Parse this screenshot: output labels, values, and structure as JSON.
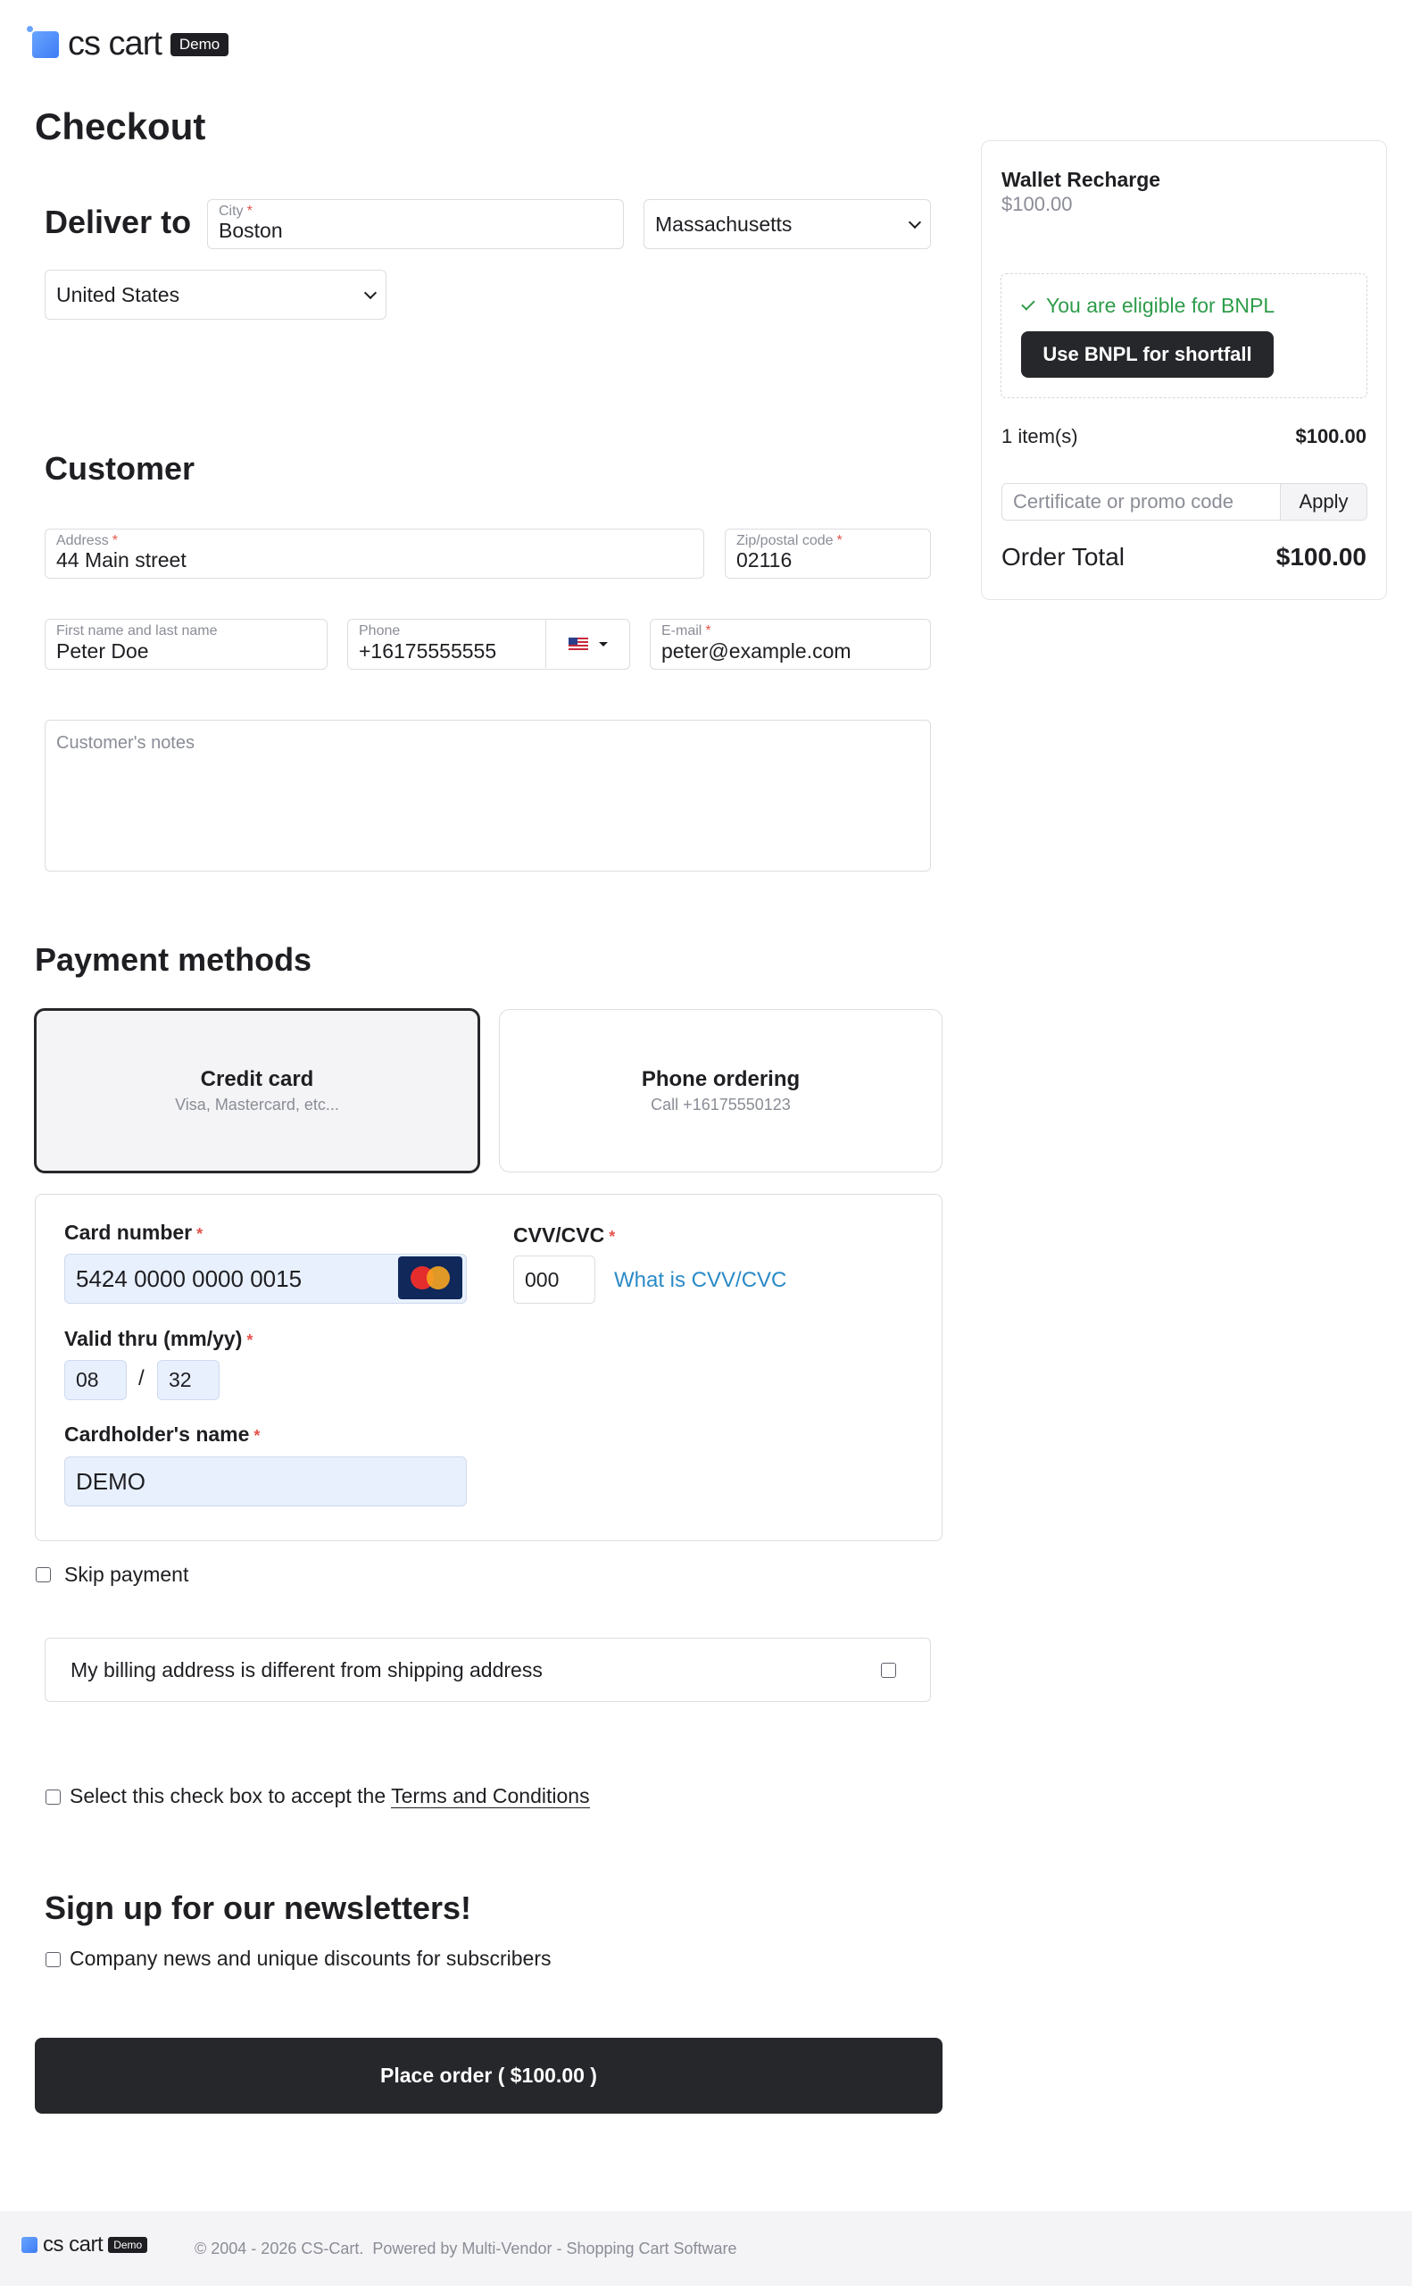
{
  "header": {
    "logo_text": "cs cart",
    "badge": "Demo"
  },
  "page_title": "Checkout",
  "deliver": {
    "title": "Deliver to",
    "city_label": "City",
    "city_value": "Boston",
    "state_value": "Massachusetts",
    "country_value": "United States"
  },
  "customer": {
    "title": "Customer",
    "address_label": "Address",
    "address_value": "44 Main street",
    "zip_label": "Zip/postal code",
    "zip_value": "02116",
    "name_label": "First name and last name",
    "name_value": "Peter Doe",
    "phone_label": "Phone",
    "phone_value": "+16175555555",
    "email_label": "E-mail",
    "email_value": "peter@example.com",
    "notes_placeholder": "Customer's notes"
  },
  "payment": {
    "title": "Payment methods",
    "methods": [
      {
        "title": "Credit card",
        "subtitle": "Visa, Mastercard, etc..."
      },
      {
        "title": "Phone ordering",
        "subtitle": "Call +16175550123"
      }
    ],
    "card_number_label": "Card number",
    "card_number_value": "5424 0000 0000 0015",
    "card_brand": "MasterCard",
    "cvv_label": "CVV/CVC",
    "cvv_value": "000",
    "cvv_link": "What is CVV/CVC",
    "valid_thru_label": "Valid thru (mm/yy)",
    "month_value": "08",
    "slash": "/",
    "year_value": "32",
    "holder_label": "Cardholder's name",
    "holder_value": "DEMO",
    "skip_label": "Skip payment"
  },
  "billing_different_label": "My billing address is different from shipping address",
  "terms": {
    "prefix": "Select this check box to accept the",
    "link": "Terms and Conditions"
  },
  "newsletter": {
    "title": "Sign up for our newsletters!",
    "option": "Company news and unique discounts for subscribers"
  },
  "place_order_label": "Place order ( $100.00 )",
  "summary": {
    "product_name": "Wallet Recharge",
    "product_price": "$100.00",
    "bnpl_eligible": "You are eligible for BNPL",
    "bnpl_button": "Use BNPL for shortfall",
    "items_count": "1 item(s)",
    "items_total": "$100.00",
    "promo_placeholder": "Certificate or promo code",
    "apply_label": "Apply",
    "order_total_label": "Order Total",
    "order_total_value": "$100.00"
  },
  "footer": {
    "logo_text": "cs cart",
    "badge": "Demo",
    "copyright": "© 2004 - 2026 CS-Cart.  Powered by Multi-Vendor - Shopping Cart Software"
  },
  "colors": {
    "accent_dark": "#26272b",
    "link_blue": "#2b8ac6",
    "success_green": "#2e9c4a",
    "required_red": "#e5534b"
  }
}
